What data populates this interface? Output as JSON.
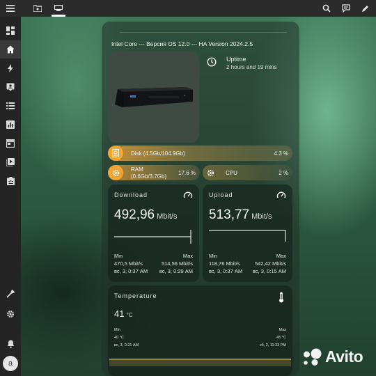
{
  "colors": {
    "accent": "#f0a531",
    "topbar": "#2b2b2b",
    "sidebar": "#242424"
  },
  "topbar": {
    "menu_icon": "menu-icon",
    "tabs": [
      "folder-icon",
      "dashboard-tab-icon"
    ],
    "actions": [
      "search-icon",
      "assist-icon",
      "edit-icon"
    ]
  },
  "sidebar": {
    "items": [
      {
        "icon": "overview-icon"
      },
      {
        "icon": "home-icon"
      },
      {
        "icon": "energy-icon"
      },
      {
        "icon": "person-card-icon"
      },
      {
        "icon": "logbook-icon"
      },
      {
        "icon": "history-icon"
      },
      {
        "icon": "store-icon"
      },
      {
        "icon": "media-icon"
      },
      {
        "icon": "todo-icon"
      },
      {
        "icon": "developer-tools-icon"
      },
      {
        "icon": "settings-icon"
      },
      {
        "icon": "notifications-icon"
      }
    ],
    "avatar_letter": "a"
  },
  "device": {
    "title": "Intel Core --- Версия OS 12.0 --- HA Version 2024.2.5",
    "uptime_label": "Uptime",
    "uptime_value": "2 hours and 19 mins"
  },
  "bars": {
    "disk": {
      "label": "Disk (4.5Gb/104.9Gb)",
      "percent": "4.3 %"
    },
    "ram": {
      "label_line1": "RAM",
      "label_line2": "(0.6Gb/3.7Gb)",
      "percent": "17.6 %"
    },
    "cpu": {
      "label": "CPU",
      "percent": "2 %"
    }
  },
  "download": {
    "title": "Download",
    "value": "492,96",
    "unit": "Mbit/s",
    "min_label": "Min",
    "min_value": "470,5 Mbit/s",
    "min_time": "вс, 3, 0:37 AM",
    "max_label": "Max",
    "max_value": "514,56 Mbit/s",
    "max_time": "вс, 3, 0:29 AM"
  },
  "upload": {
    "title": "Upload",
    "value": "513,77",
    "unit": "Mbit/s",
    "min_label": "Min",
    "min_value": "118,76 Mbit/s",
    "min_time": "вс, 3, 0:37 AM",
    "max_label": "Max",
    "max_value": "542,42 Mbit/s",
    "max_time": "вс, 3, 0:15 AM"
  },
  "temperature": {
    "title": "Temperature",
    "value": "41",
    "unit": "°C",
    "min_label": "Min",
    "min_value": "40 °C",
    "min_time": "вс, 3, 0:21 AM",
    "max_label": "Max",
    "max_value": "45 °C",
    "max_time": "сб, 2, 11:33 PM"
  },
  "watermark": {
    "brand": "Avito"
  }
}
